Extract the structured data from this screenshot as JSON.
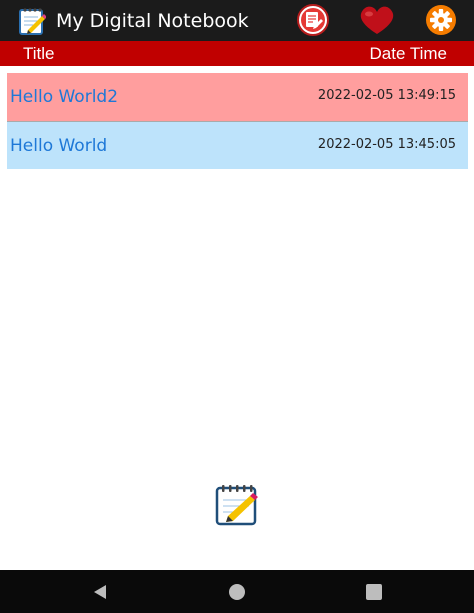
{
  "appbar": {
    "title": "My Digital Notebook",
    "icons": [
      "notepad-icon",
      "edit-note-icon",
      "heart-icon",
      "gear-icon"
    ]
  },
  "columns": {
    "title_label": "Title",
    "date_label": "Date Time"
  },
  "notes": [
    {
      "title": "Hello World2",
      "datetime": "2022-02-05 13:49:15",
      "color": "#ff9e9e"
    },
    {
      "title": "Hello World",
      "datetime": "2022-02-05 13:45:05",
      "color": "#bde3fb"
    }
  ],
  "colors": {
    "appbar": "#1b1b1b",
    "header": "#c00000",
    "title_text": "#1e78d7",
    "navbar": "#0a0a0a"
  },
  "fab": {
    "icon": "notepad-pencil-icon"
  },
  "navbar": {
    "icons": [
      "back-icon",
      "home-icon",
      "recents-icon"
    ]
  }
}
